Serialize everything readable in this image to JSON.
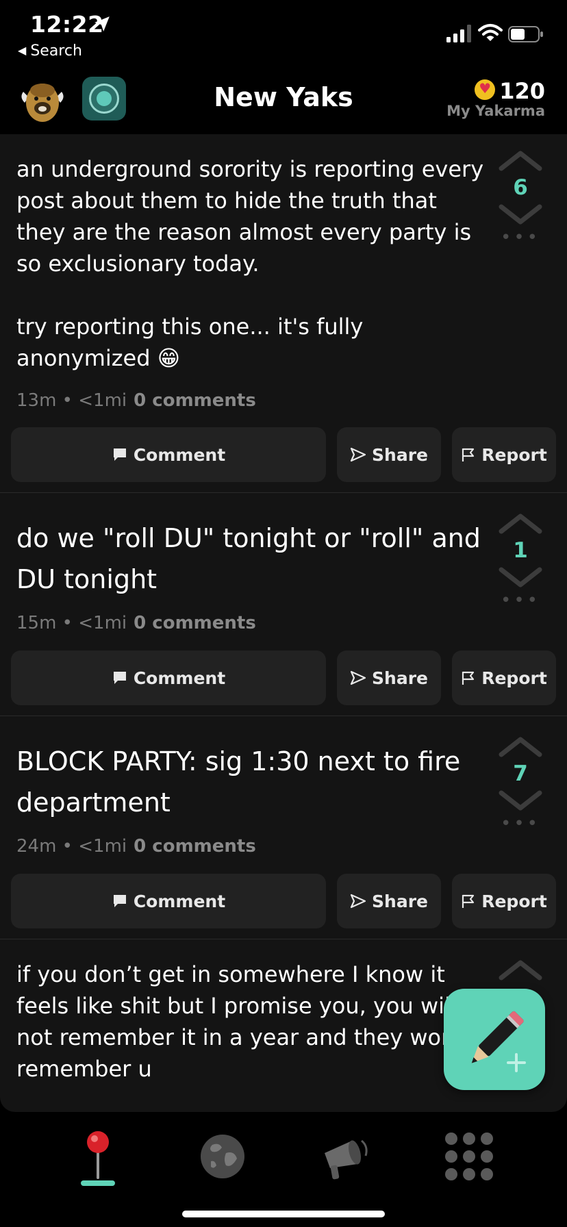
{
  "status_bar": {
    "time": "12:22",
    "back_label": "Search"
  },
  "header": {
    "title": "New Yaks",
    "karma_value": "120",
    "karma_label": "My Yakarma"
  },
  "posts": [
    {
      "text": "an underground sorority is reporting every post about them to hide the truth that they are the reason almost every party is so exclusionary today.\n\ntry reporting this one... it's fully anonymized 😁",
      "meta": "13m • <1mi",
      "comments": "0 comments",
      "votes": "6"
    },
    {
      "text": "do we \"roll DU\" tonight or \"roll\" and DU tonight",
      "meta": "15m • <1mi",
      "comments": "0 comments",
      "votes": "1"
    },
    {
      "text": "BLOCK PARTY: sig 1:30 next to fire department",
      "meta": "24m • <1mi",
      "comments": "0 comments",
      "votes": "7"
    },
    {
      "text": "if you don’t get in somewhere I know it feels like shit but I promise you, you will not remember it in a year and they won’t remember u"
    }
  ],
  "actions": {
    "comment_label": "Comment",
    "share_label": "Share",
    "report_label": "Report"
  },
  "tabs": [
    {
      "icon": "pin-icon"
    },
    {
      "icon": "globe-icon"
    },
    {
      "icon": "megaphone-icon"
    },
    {
      "icon": "grid-icon"
    }
  ],
  "colors": {
    "accent": "#5fd3b7",
    "background": "#000000",
    "card": "#141414",
    "button": "#222222",
    "muted_text": "#7a7a7a"
  }
}
